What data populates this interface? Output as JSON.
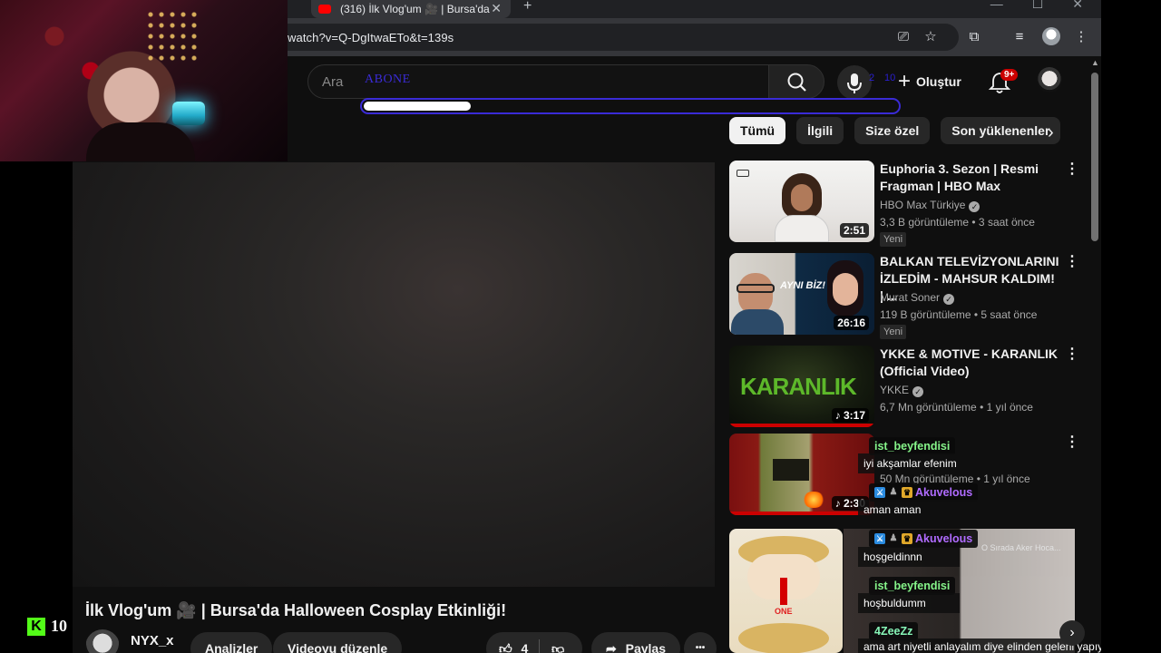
{
  "browser": {
    "tab_title": "(316) İlk Vlog'um 🎥 | Bursa'da",
    "tab_close": "✕",
    "new_tab": "+",
    "url": "watch?v=Q-DgItwaETo&t=139s",
    "window_controls": [
      "—",
      "☐",
      "✕"
    ]
  },
  "header": {
    "search_placeholder": "Ara",
    "overlay_text": "ABONE",
    "overlay_count_a": "2",
    "overlay_count_b": "10",
    "create_label": "Oluştur",
    "notification_badge": "9+"
  },
  "overlay_progress": {
    "fraction": 0.2
  },
  "chips": [
    "Tümü",
    "İlgili",
    "Size özel",
    "Son yüklenenler"
  ],
  "chips_next": "›",
  "videos": [
    {
      "title": "Euphoria 3. Sezon | Resmi Fragman | HBO Max",
      "channel": "HBO Max Türkiye",
      "verified": true,
      "meta": "3,3 B görüntüleme • 3 saat önce",
      "badge": "Yeni",
      "duration": "2:51"
    },
    {
      "title": "BALKAN TELEVİZYONLARINI İZLEDİM - MAHSUR KALDIM! | ...",
      "channel": "Murat Soner",
      "verified": true,
      "meta": "119 B görüntüleme • 5 saat önce",
      "badge": "Yeni",
      "duration": "26:16",
      "thumb_text": "AYNI BİZ!"
    },
    {
      "title": "YKKE & MOTIVE - KARANLIK (Official Video)",
      "channel": "YKKE",
      "verified": true,
      "meta": "6,7 Mn görüntüleme • 1 yıl önce",
      "duration": "♪ 3:17",
      "thumb_text": "KARANLIK"
    },
    {
      "title": "",
      "channel": "",
      "meta": "50 Mn görüntüleme • 1 yıl önce",
      "duration": "♪ 2:30"
    },
    {
      "thumb_text": "ONE",
      "caption": "O Sırada Aker Hoca..."
    }
  ],
  "kebab": "⋮",
  "main_video": {
    "title": "İlk Vlog'um 🎥 | Bursa'da Halloween Cosplay Etkinliği!",
    "channel_name": "NYX_x",
    "analytics_label": "Analizler",
    "edit_label": "Videoyu düzenle",
    "likes": "4",
    "share_label": "Paylaş",
    "more": "•••"
  },
  "kick": {
    "logo": "K",
    "count": "10"
  },
  "chat": [
    {
      "user": "ist_beyfendisi",
      "message": "iyi akşamlar efenim"
    },
    {
      "user": "Akuvelous",
      "message": "aman aman"
    },
    {
      "user": "Akuvelous",
      "message": "hoşgeldinnn"
    },
    {
      "user": "ist_beyfendisi",
      "message": "hoşbuldumm"
    },
    {
      "user": "4ZeeZz",
      "message": "ama art niyetli anlayalım diye elinden geleni yapıyor sonra"
    }
  ],
  "colors": {
    "youtube_bg": "#0f0f0f",
    "accent_blue": "#3a2bd6",
    "kick_green": "#53fc18",
    "notification_red": "#cc0000"
  }
}
